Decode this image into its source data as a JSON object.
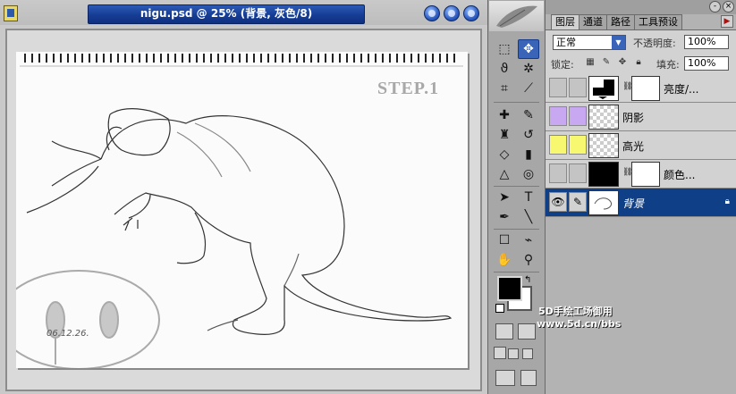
{
  "document": {
    "title": "nigu.psd @ 25% (背景, 灰色/8)",
    "step_label": "STEP.1",
    "sketch_date": "06.12.26."
  },
  "toolbox": {
    "tools": [
      {
        "name": "marquee",
        "glyph": "⬚"
      },
      {
        "name": "move",
        "glyph": "✥"
      },
      {
        "name": "lasso",
        "glyph": "ϑ"
      },
      {
        "name": "magic-wand",
        "glyph": "✲"
      },
      {
        "name": "crop",
        "glyph": "⌗"
      },
      {
        "name": "slice",
        "glyph": "⟋"
      },
      {
        "name": "healing",
        "glyph": "✚"
      },
      {
        "name": "brush",
        "glyph": "✎"
      },
      {
        "name": "stamp",
        "glyph": "♜"
      },
      {
        "name": "history-brush",
        "glyph": "↺"
      },
      {
        "name": "eraser",
        "glyph": "◇"
      },
      {
        "name": "gradient",
        "glyph": "▮"
      },
      {
        "name": "blur",
        "glyph": "△"
      },
      {
        "name": "dodge",
        "glyph": "◎"
      },
      {
        "name": "path-select",
        "glyph": "➤"
      },
      {
        "name": "type",
        "glyph": "T"
      },
      {
        "name": "pen",
        "glyph": "✒"
      },
      {
        "name": "line",
        "glyph": "╲"
      },
      {
        "name": "notes",
        "glyph": "☐"
      },
      {
        "name": "eyedropper",
        "glyph": "⌁"
      },
      {
        "name": "hand",
        "glyph": "✋"
      },
      {
        "name": "zoom",
        "glyph": "⚲"
      }
    ],
    "foreground_color": "#000000",
    "background_color": "#ffffff"
  },
  "layers_panel": {
    "tabs": [
      "图层",
      "通道",
      "路径",
      "工具预设"
    ],
    "blend_mode": "正常",
    "opacity_label": "不透明度:",
    "opacity_value": "100%",
    "lock_label": "锁定:",
    "fill_label": "填充:",
    "fill_value": "100%",
    "layers": [
      {
        "name": "亮度/...",
        "color_tag": "",
        "visible": false,
        "thumb": "adjustment"
      },
      {
        "name": "阴影",
        "color_tag": "#c8a8f0",
        "visible": false,
        "thumb": "checker"
      },
      {
        "name": "高光",
        "color_tag": "#f8f870",
        "visible": false,
        "thumb": "checker"
      },
      {
        "name": "颜色...",
        "color_tag": "",
        "visible": false,
        "thumb": "fill-black"
      },
      {
        "name": "背景",
        "color_tag": "",
        "visible": true,
        "thumb": "sketch",
        "locked": true
      }
    ]
  },
  "watermark": {
    "line1": "5D手绘工场御用",
    "line2": "www.5d.cn/bbs"
  }
}
